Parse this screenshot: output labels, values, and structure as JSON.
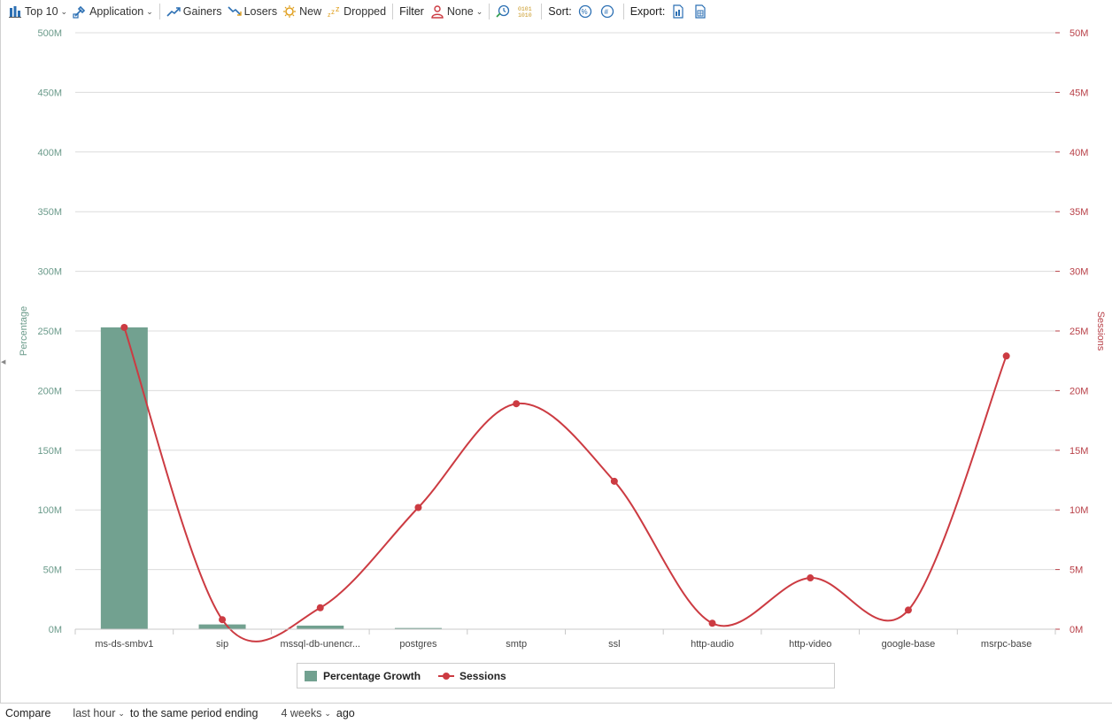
{
  "toolbar": {
    "top": "Top 10",
    "group_by": "Application",
    "gainers": "Gainers",
    "losers": "Losers",
    "new": "New",
    "dropped": "Dropped",
    "filter_label": "Filter",
    "filter_value": "None",
    "sort_label": "Sort:",
    "export_label": "Export:"
  },
  "colors": {
    "bar": "#72a190",
    "line": "#cc3b42",
    "left_axis": "#6a9a8a",
    "right_axis": "#b84048",
    "grid": "#dcdcdc"
  },
  "chart_data": {
    "type": "bar",
    "categories": [
      "ms-ds-smbv1",
      "sip",
      "mssql-db-unencr...",
      "postgres",
      "smtp",
      "ssl",
      "http-audio",
      "http-video",
      "google-base",
      "msrpc-base"
    ],
    "series": [
      {
        "name": "Percentage Growth",
        "type": "bar",
        "axis": "left",
        "values": [
          253,
          4,
          3,
          1,
          0,
          0,
          0,
          0,
          0,
          0
        ]
      },
      {
        "name": "Sessions",
        "type": "line",
        "axis": "right",
        "values": [
          25.3,
          0.8,
          1.8,
          10.2,
          18.9,
          12.4,
          0.5,
          4.3,
          1.6,
          22.9
        ]
      }
    ],
    "ylabel": "Percentage",
    "y2label": "Sessions",
    "ylim": [
      0,
      500
    ],
    "y2lim": [
      0,
      50
    ],
    "yticks": [
      "0M",
      "50M",
      "100M",
      "150M",
      "200M",
      "250M",
      "300M",
      "350M",
      "400M",
      "450M",
      "500M"
    ],
    "y2ticks": [
      "0M",
      "5M",
      "10M",
      "15M",
      "20M",
      "25M",
      "30M",
      "35M",
      "40M",
      "45M",
      "50M"
    ],
    "grid": true,
    "legend": "bottom"
  },
  "footer": {
    "compare": "Compare",
    "period": "last hour",
    "middle": "to the same period ending",
    "weeks": "4 weeks",
    "ago": "ago"
  }
}
